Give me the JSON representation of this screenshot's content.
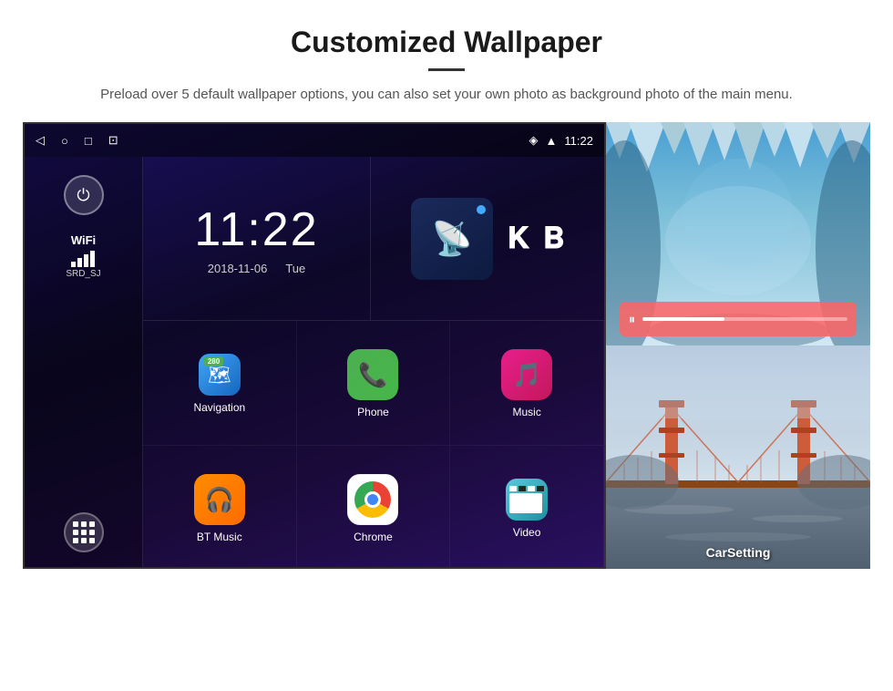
{
  "header": {
    "title": "Customized Wallpaper",
    "description": "Preload over 5 default wallpaper options, you can also set your own photo as background photo of the main menu."
  },
  "screen": {
    "time": "11:22",
    "date": "2018-11-06",
    "day": "Tue",
    "status_time": "11:22",
    "wifi_label": "WiFi",
    "wifi_ssid": "SRD_SJ"
  },
  "apps": [
    {
      "label": "Navigation"
    },
    {
      "label": "Phone"
    },
    {
      "label": "Music"
    },
    {
      "label": "BT Music"
    },
    {
      "label": "Chrome"
    },
    {
      "label": "Video"
    }
  ],
  "wallpapers": [
    {
      "label": "CarSetting"
    }
  ]
}
